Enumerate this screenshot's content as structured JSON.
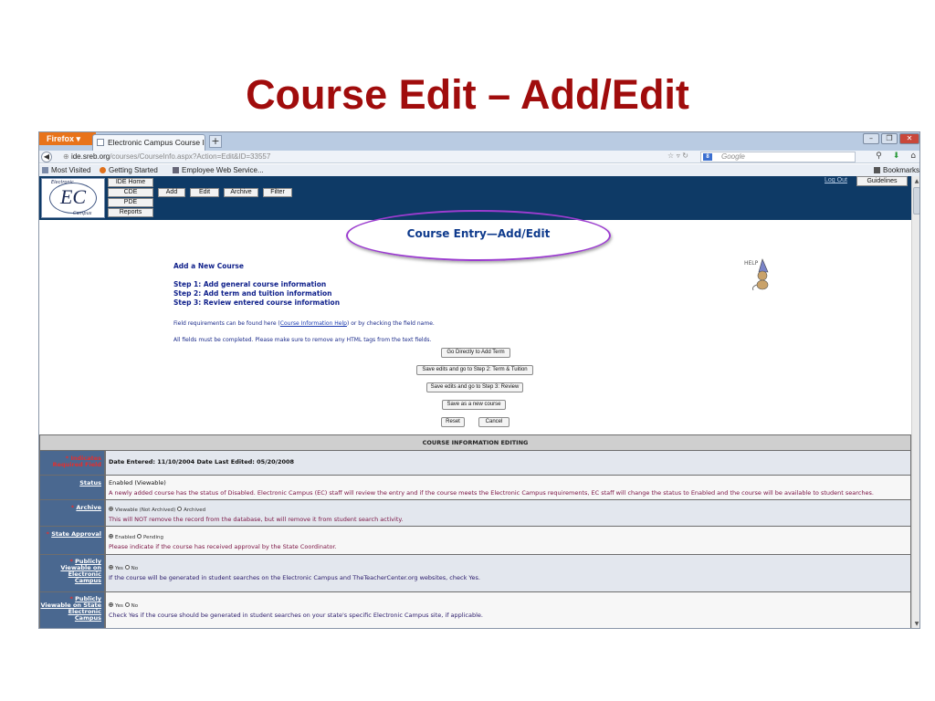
{
  "slide": {
    "title": "Course Edit – Add/Edit"
  },
  "browser": {
    "firefox_label": "Firefox",
    "tab_title": "Electronic Campus Course Infor...",
    "new_tab": "+",
    "url_host": "ide.sreb.org",
    "url_path": "/courses/CourseInfo.aspx?Action=Edit&ID=33557",
    "search_placeholder": "Google",
    "search_engine": "8",
    "bookmarks": [
      "Most Visited",
      "Getting Started",
      "Employee Web Service..."
    ],
    "bookmarks_menu": "Bookmarks"
  },
  "site": {
    "logo": {
      "text": "EC",
      "top": "Electronic",
      "bottom": "Campus"
    },
    "sidenav": [
      "IDE Home",
      "CDE",
      "PDE",
      "Reports"
    ],
    "toolbar": [
      "Add",
      "Edit",
      "Archive",
      "Filter"
    ],
    "logout": "Log Out",
    "guidelines": "Guidelines"
  },
  "content": {
    "entry_title": "Course Entry—Add/Edit",
    "help_text": "HELP",
    "add_new": "Add a New Course",
    "steps": [
      "Step 1: Add general course information",
      "Step 2: Add term and tuition information",
      "Step 3: Review entered course information"
    ],
    "note1_pre": "Field requirements can be found here (",
    "note1_link": "Course Information Help",
    "note1_post": ") or by checking the field name.",
    "note2": "All fields must be completed. Please make sure to remove any HTML tags from the text fields.",
    "buttons": {
      "go_add_term": "Go Directly to Add Term",
      "save_step2": "Save edits and go to Step 2: Term & Tuition",
      "save_step3": "Save edits and go to Step 3: Review",
      "save_new": "Save as a new course",
      "reset": "Reset",
      "cancel": "Cancel"
    }
  },
  "form": {
    "header": "COURSE INFORMATION EDITING",
    "rows": [
      {
        "label_star": "*",
        "label": "Indicates Required Field",
        "value": "Date Entered: 11/10/2004     Date Last Edited: 05/20/2008"
      },
      {
        "label": "Status",
        "value": "Enabled (Viewable)",
        "desc": "A newly added course has the status of Disabled. Electronic Campus (EC) staff will review the entry and if the course meets the Electronic Campus requirements, EC staff will change the status to Enabled and the course will be available to student searches."
      },
      {
        "label_star": "*",
        "label": "Archive",
        "options": [
          "Viewable (Not Archived)",
          "Archived"
        ],
        "desc": "This will NOT remove the record from the database, but will remove it from student search activity."
      },
      {
        "label_star": "*",
        "label": "State Approval",
        "options": [
          "Enabled",
          "Pending"
        ],
        "desc": "Please indicate if the course has received approval by the State Coordinator."
      },
      {
        "label_star": "*",
        "label": "Publicly Viewable on Electronic Campus",
        "options": [
          "Yes",
          "No"
        ],
        "desc": "If the course will be generated in student searches on the Electronic Campus and TheTeacherCenter.org websites, check Yes."
      },
      {
        "label_star": "*",
        "label": "Publicly Viewable on State Electronic Campus",
        "options": [
          "Yes",
          "No"
        ],
        "desc": "Check Yes if the course should be generated in student searches on your state's specific Electronic Campus site, if applicable."
      }
    ]
  },
  "colors": {
    "slide_title": "#a00c0c",
    "site_header": "#0e3a66",
    "label_bg": "#4a6890",
    "ellipse": "#9b3ccf"
  }
}
